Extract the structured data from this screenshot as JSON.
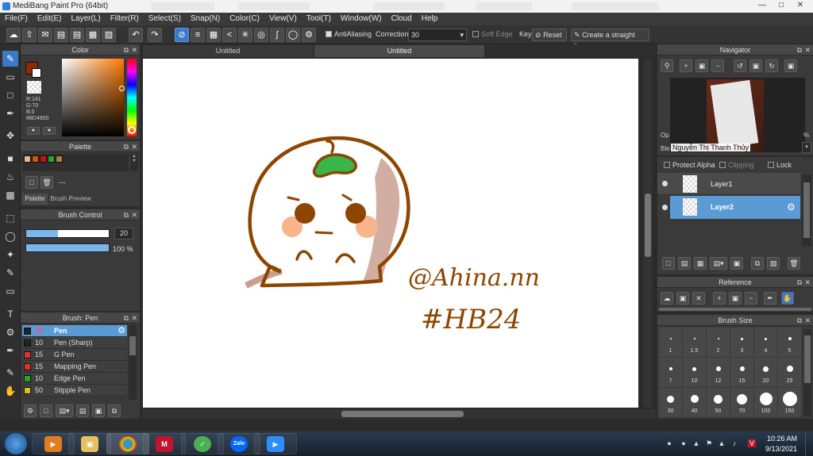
{
  "window": {
    "title": "MediBang Paint Pro (64bit)"
  },
  "menu": [
    "File(F)",
    "Edit(E)",
    "Layer(L)",
    "Filter(R)",
    "Select(S)",
    "Snap(N)",
    "Color(C)",
    "View(V)",
    "Tool(T)",
    "Window(W)",
    "Cloud",
    "Help"
  ],
  "toolbar": {
    "antialiasing": "AntiAliasing",
    "correction_label": "Correction",
    "correction_value": "30",
    "soft_edge": "Soft Edge",
    "key_label": "Key",
    "reset_label": "Reset",
    "straight_line_label": "Create a straight line"
  },
  "document": {
    "tabs": [
      "Untitled",
      "Untitled"
    ]
  },
  "color_panel": {
    "title": "Color",
    "r": "R:141",
    "g": "G:70",
    "b": "B:0",
    "hex": "#8D4600",
    "primary": "#8d2a00",
    "secondary": "#ffffff"
  },
  "palette_panel": {
    "title": "Palette",
    "swatches": [
      "#f5b58a",
      "#c75a1a",
      "#cc1010",
      "#22aa22",
      "#b07a4a"
    ],
    "name": "---",
    "tabs": [
      "Palette",
      "Brush Preview"
    ]
  },
  "brush_control": {
    "title": "Brush Control",
    "size_value": "20",
    "opacity_value": "100 %",
    "size_level": 0.38,
    "opacity_level": 1.0
  },
  "brush_panel": {
    "title": "Brush: Pen",
    "items": [
      {
        "size": "20",
        "name": "Pen",
        "color": "#222222"
      },
      {
        "size": "10",
        "name": "Pen (Sharp)",
        "color": "#222222"
      },
      {
        "size": "15",
        "name": "G Pen",
        "color": "#e03030"
      },
      {
        "size": "15",
        "name": "Mapping Pen",
        "color": "#e03030"
      },
      {
        "size": "10",
        "name": "Edge Pen",
        "color": "#22aa22"
      },
      {
        "size": "50",
        "name": "Stipple Pen",
        "color": "#e0c020"
      }
    ]
  },
  "canvas_art": {
    "handle": "@Ahina.nn",
    "tag": "#HB24"
  },
  "navigator": {
    "title": "Navigator",
    "overlay_name": "Nguyễn Thị Thanh Thủy",
    "row_labels": [
      "Op",
      "Ble"
    ],
    "percent_label": "%"
  },
  "layers": {
    "protect_alpha": "Protect Alpha",
    "clipping": "Clipping",
    "lock": "Lock",
    "items": [
      {
        "name": "Layer1",
        "selected": false
      },
      {
        "name": "Layer2",
        "selected": true
      }
    ]
  },
  "reference": {
    "title": "Reference"
  },
  "brush_size": {
    "title": "Brush Size",
    "labels": [
      "1",
      "1.5",
      "2",
      "3",
      "4",
      "5",
      "7",
      "10",
      "12",
      "15",
      "20",
      "25",
      "30",
      "40",
      "50",
      "70",
      "100",
      "150"
    ]
  },
  "taskbar": {
    "time": "10:26 AM",
    "date": "9/13/2021",
    "apps": [
      "explorer",
      "media",
      "files",
      "chrome",
      "medibang",
      "evkey",
      "zalo",
      "zoom"
    ],
    "app_labels": {
      "zalo": "Zalo"
    }
  }
}
